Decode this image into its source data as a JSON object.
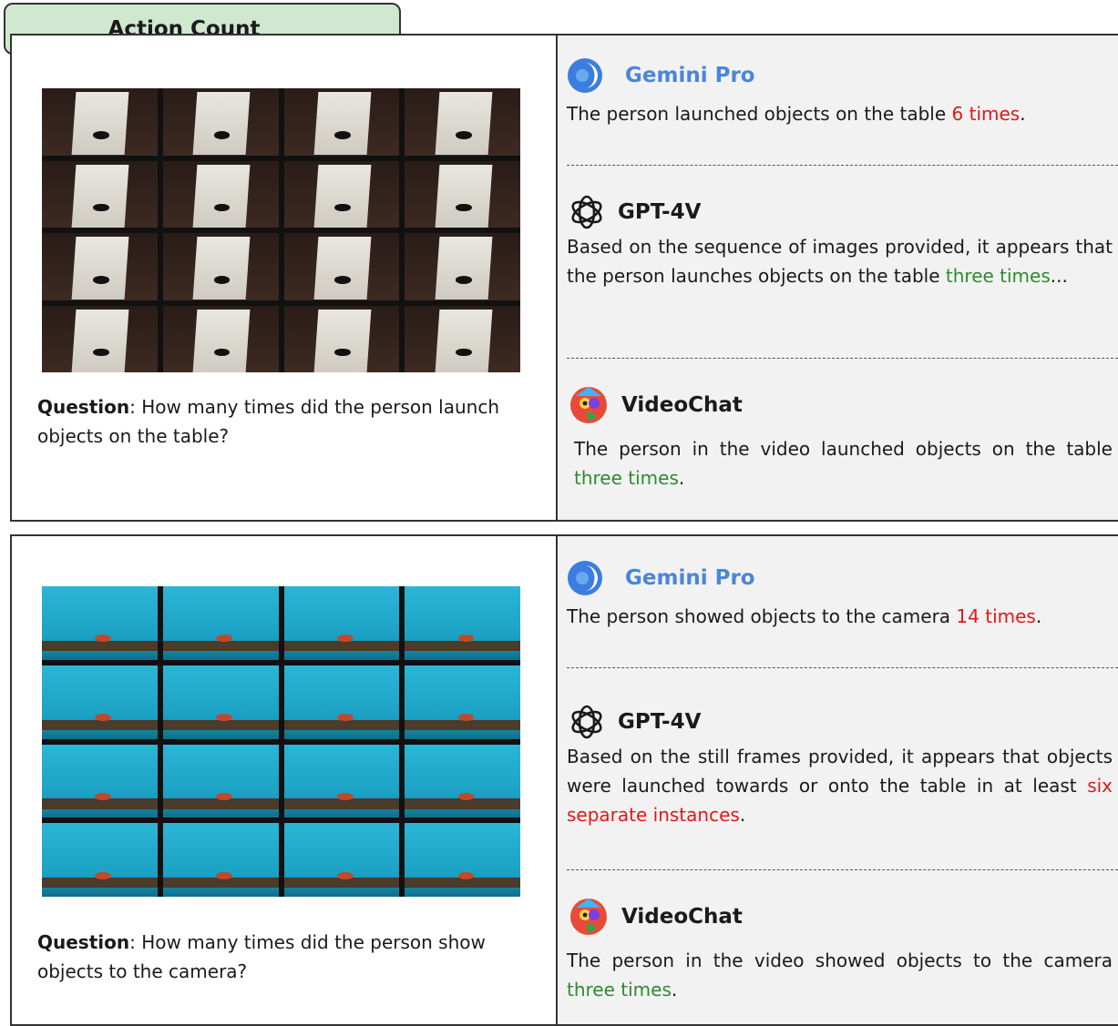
{
  "header": {
    "title": "Action Count"
  },
  "examples": [
    {
      "question_label": "Question",
      "question_text": ": How many times did the person launch objects on the table?",
      "models": {
        "gemini": {
          "name": "Gemini Pro",
          "text_before": "The person launched objects on the table ",
          "highlight": "6 times",
          "text_after": ".",
          "highlight_color": "#e01818"
        },
        "gpt4v": {
          "name": "GPT-4V",
          "text_before": "Based on the sequence of images provided, it appears that the person launches objects on the table ",
          "highlight": "three times",
          "text_after": "...",
          "highlight_color": "#2f8a2f"
        },
        "videochat": {
          "name": "VideoChat",
          "text_before": "The person in the video launched objects on the table ",
          "highlight": "three times",
          "text_after": ".",
          "highlight_color": "#2f8a2f"
        }
      }
    },
    {
      "question_label": "Question",
      "question_text": ": How many times did the person show objects to the camera?",
      "models": {
        "gemini": {
          "name": "Gemini Pro",
          "text_before": "The person showed objects to the camera ",
          "highlight": "14 times",
          "text_after": ".",
          "highlight_color": "#e01818"
        },
        "gpt4v": {
          "name": "GPT-4V",
          "text_before": "Based on the still frames provided, it appears that objects were launched towards or onto the table in at least ",
          "highlight": "six separate instances",
          "text_after": ".",
          "highlight_color": "#e01818"
        },
        "videochat": {
          "name": "VideoChat",
          "text_before": "The person in the video showed objects to the camera ",
          "highlight": "three times",
          "text_after": ".",
          "highlight_color": "#2f8a2f"
        }
      }
    }
  ],
  "icons": {
    "gemini": "gemini-logo-icon",
    "gpt4v": "openai-logo-icon",
    "videochat": "parrot-logo-icon"
  },
  "colors": {
    "tab_bg": "#cfe8cf",
    "right_bg": "#f2f2f2",
    "gemini_name": "#4a86d8",
    "wrong": "#e01818",
    "correct": "#2f8a2f"
  }
}
